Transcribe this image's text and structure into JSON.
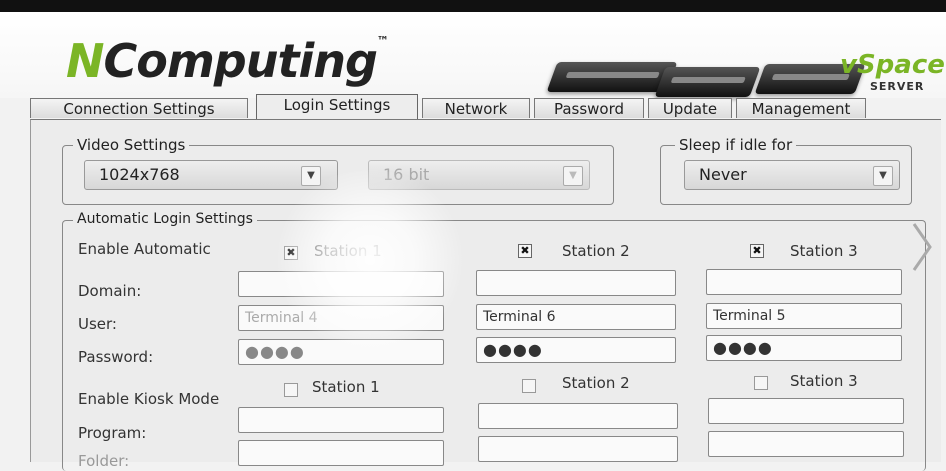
{
  "brand": {
    "name_prefix": "N",
    "name_rest": "Computing",
    "tm": "™",
    "product": "vSpace",
    "product_sub": "SERVER"
  },
  "tabs": [
    {
      "label": "Connection Settings"
    },
    {
      "label": "Login Settings"
    },
    {
      "label": "Network"
    },
    {
      "label": "Password"
    },
    {
      "label": "Update"
    },
    {
      "label": "Management"
    }
  ],
  "video": {
    "legend": "Video Settings",
    "resolution": "1024x768",
    "depth": "16 bit"
  },
  "sleep": {
    "legend": "Sleep if idle for",
    "value": "Never"
  },
  "auto_login": {
    "legend": "Automatic Login Settings",
    "enable_label": "Enable Automatic",
    "stations": [
      "Station 1",
      "Station 2",
      "Station 3"
    ],
    "domain_label": "Domain:",
    "user_label": "User:",
    "password_label": "Password:",
    "domains": [
      "",
      "",
      ""
    ],
    "users": [
      "Terminal 4",
      "Terminal 6",
      "Terminal 5"
    ],
    "passwords": [
      "●●●●",
      "●●●●",
      "●●●●"
    ],
    "checked_mark": "✖"
  },
  "kiosk": {
    "enable_label": "Enable Kiosk Mode",
    "stations": [
      "Station 1",
      "Station 2",
      "Station 3"
    ],
    "program_label": "Program:",
    "folder_label": "Folder:"
  },
  "icons": {
    "dropdown": "▼",
    "next": "chevron-right-icon"
  },
  "colors": {
    "brand_green": "#7bb526"
  }
}
